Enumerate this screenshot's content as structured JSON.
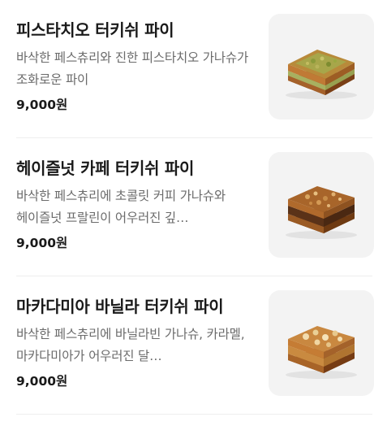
{
  "menu": {
    "items": [
      {
        "name": "피스타치오 터키쉬 파이",
        "description": "바삭한 페스츄리와 진한 피스타치오 가나슈가 조화로운 파이",
        "price": "9,000원",
        "image": "pistachio-turkish-pie-image"
      },
      {
        "name": "헤이즐넛 카페 터키쉬 파이",
        "description": "바삭한 페스츄리에 초콜릿 커피 가나슈와 헤이즐넛 프랄린이 어우러진 깊…",
        "price": "9,000원",
        "image": "hazelnut-cafe-turkish-pie-image"
      },
      {
        "name": "마카다미아 바닐라 터키쉬 파이",
        "description": "바삭한 페스츄리에 바닐라빈 가나슈, 카라멜, 마카다미아가 어우러진 달…",
        "price": "9,000원",
        "image": "macadamia-vanilla-turkish-pie-image"
      }
    ]
  },
  "colors": {
    "title": "#1a1a1a",
    "description": "#6b6b6b",
    "thumbnail_bg": "#f3f3f3",
    "divider": "#eeeeee"
  }
}
